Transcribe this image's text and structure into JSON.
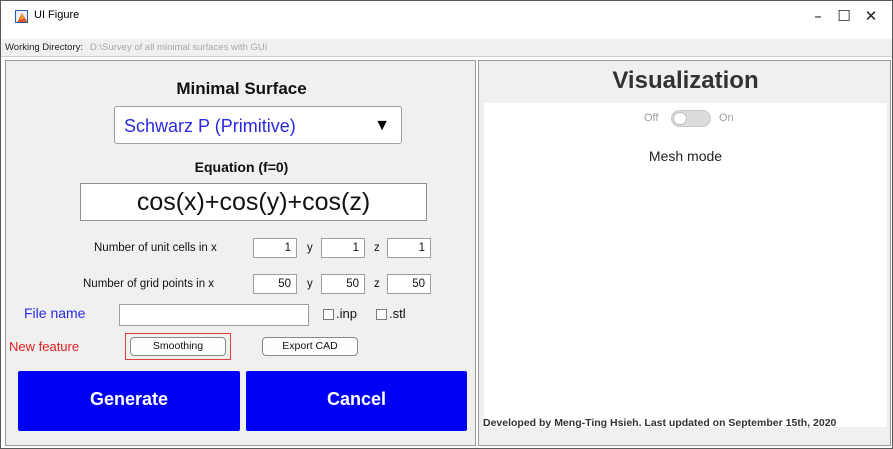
{
  "window": {
    "title": "UI Figure",
    "controls": {
      "minimize": "–",
      "maximize": "☐",
      "close": "✕"
    }
  },
  "working_directory": {
    "label": "Working Directory:",
    "value": "D:\\Survey of all minimal surfaces with GUI"
  },
  "left_panel": {
    "heading": "Minimal Surface",
    "surface_select": {
      "value": "Schwarz P (Primitive)",
      "arrow": "▼"
    },
    "equation_heading": "Equation (f=0)",
    "equation": "cos(x)+cos(y)+cos(z)",
    "unit_cells": {
      "label": "Number of unit cells in  x",
      "y_label": "y",
      "z_label": "z",
      "x": "1",
      "y": "1",
      "z": "1"
    },
    "grid_points": {
      "label": "Number of grid points in  x",
      "y_label": "y",
      "z_label": "z",
      "x": "50",
      "y": "50",
      "z": "50"
    },
    "file_name": {
      "label": "File name",
      "value": ""
    },
    "formats": {
      "inp": ".inp",
      "stl": ".stl"
    },
    "new_feature": {
      "label": "New feature",
      "smoothing": "Smoothing",
      "export_cad": "Export CAD"
    },
    "generate_label": "Generate",
    "cancel_label": "Cancel"
  },
  "right_panel": {
    "heading": "Visualization",
    "switch": {
      "off": "Off",
      "on": "On",
      "state": "off"
    },
    "mesh_mode": "Mesh mode",
    "credit": "Developed by Meng-Ting Hsieh. Last updated on September 15th, 2020"
  },
  "colors": {
    "accent_blue": "#0000f5",
    "link_blue": "#2a2ae0",
    "feature_red": "#e02020",
    "panel_gray": "#f0f0f0"
  }
}
